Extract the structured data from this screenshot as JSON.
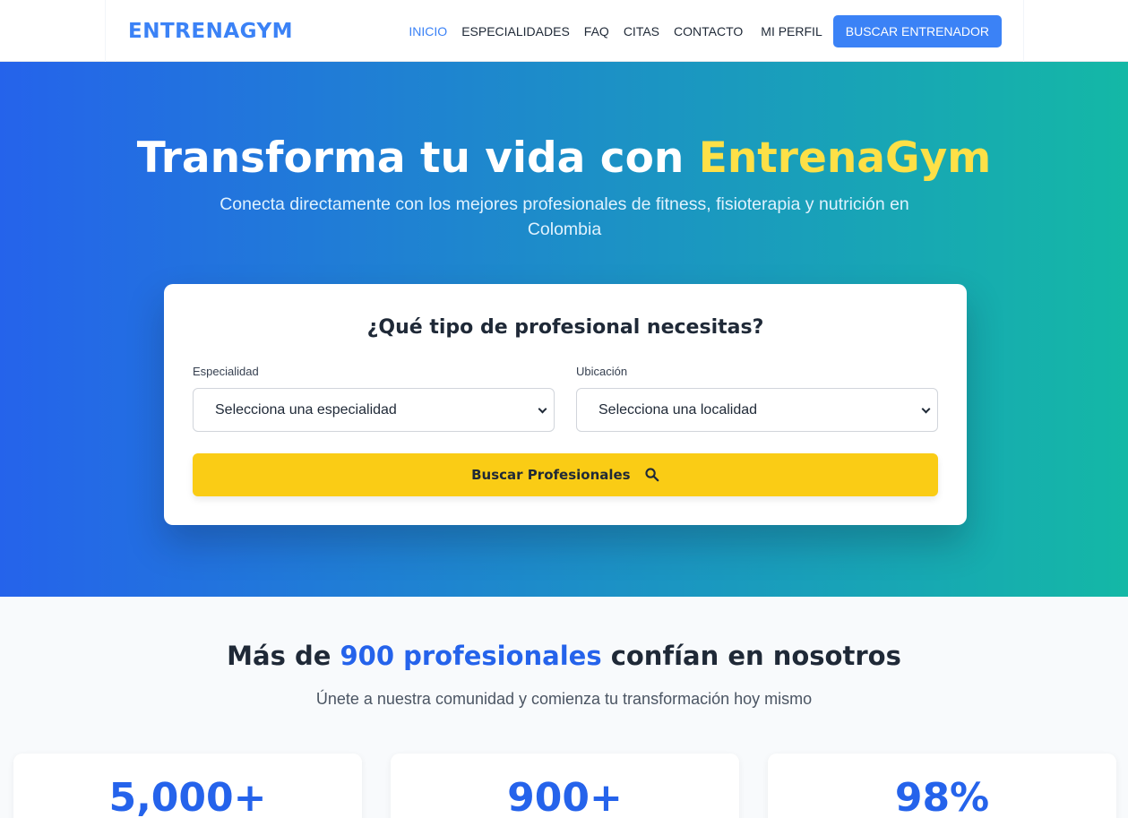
{
  "nav": {
    "brand": "ENTRENAGYM",
    "links": [
      "INICIO",
      "ESPECIALIDADES",
      "FAQ",
      "CITAS",
      "CONTACTO"
    ],
    "profile": "MI PERFIL",
    "cta": "BUSCAR ENTRENADOR"
  },
  "hero": {
    "title_prefix": "Transforma tu vida con ",
    "title_accent": "EntrenaGym",
    "subtitle": "Conecta directamente con los mejores profesionales de fitness, fisioterapia y nutrición en Colombia"
  },
  "search": {
    "title": "¿Qué tipo de profesional necesitas?",
    "specialty_label": "Especialidad",
    "specialty_value": "Selecciona una especialidad",
    "location_label": "Ubicación",
    "location_value": "Selecciona una localidad",
    "button": "Buscar Profesionales",
    "button_icon": "search-icon"
  },
  "stats": {
    "title_prefix": "Más de ",
    "title_accent": "900 profesionales",
    "title_suffix": " confían en nosotros",
    "subtitle": "Únete a nuestra comunidad y comienza tu transformación hoy mismo",
    "items": [
      "5,000+",
      "900+",
      "98%"
    ]
  },
  "colors": {
    "brand_blue": "#3b82f6",
    "hero_start": "#2563eb",
    "hero_end": "#14b8a6",
    "accent_yellow": "#facc15"
  }
}
